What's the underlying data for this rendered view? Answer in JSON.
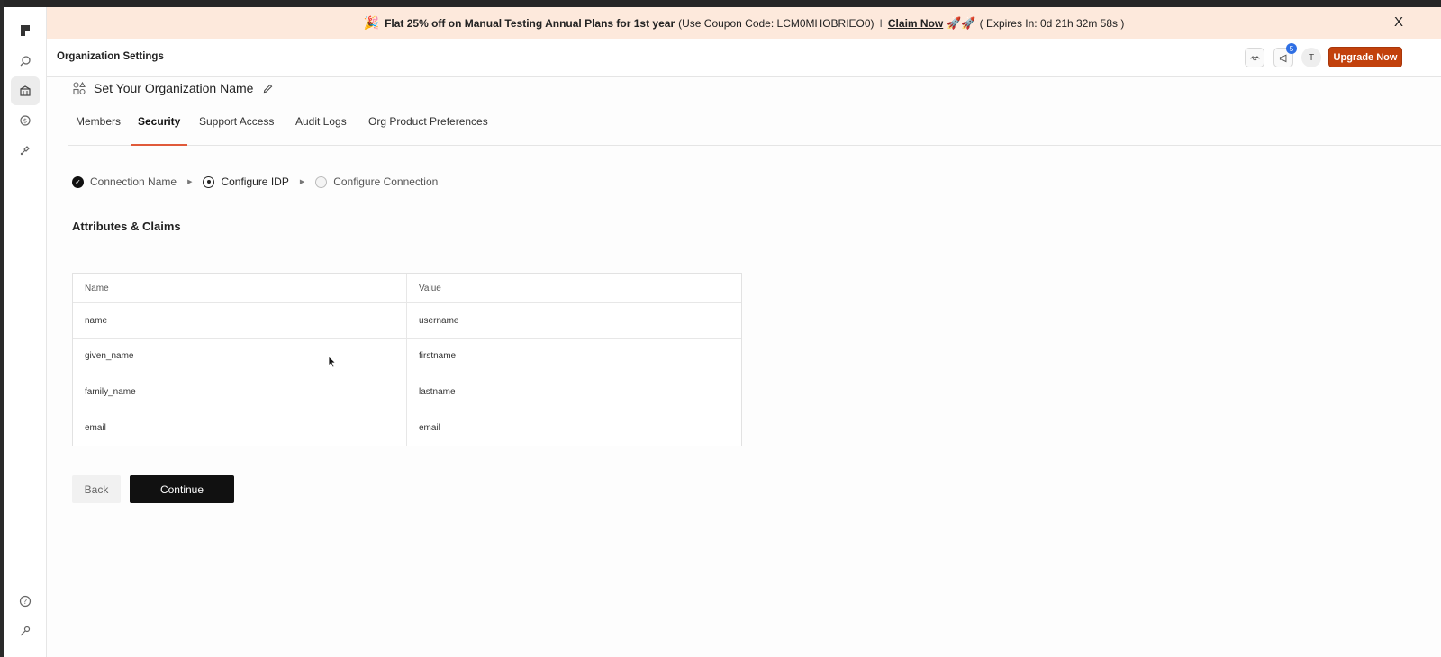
{
  "banner": {
    "emoji_left": "🎉",
    "promo_bold": "Flat 25% off on Manual Testing Annual Plans for 1st year",
    "coupon_text": "(Use Coupon Code: LCM0MHOBRIEO0)",
    "separator": "I",
    "claim_label": "Claim Now",
    "emoji_right": "🚀🚀",
    "expires_text": "( Expires In: 0d 21h 32m 58s )",
    "close_label": "X"
  },
  "header": {
    "title": "Organization Settings",
    "notifications_count": "5",
    "avatar_initial": "T",
    "upgrade_label": "Upgrade Now"
  },
  "org": {
    "name_label": "Set Your Organization Name"
  },
  "tabs": [
    {
      "label": "Members"
    },
    {
      "label": "Security"
    },
    {
      "label": "Support Access"
    },
    {
      "label": "Audit Logs"
    },
    {
      "label": "Org Product Preferences"
    }
  ],
  "active_tab": "Security",
  "stepper": [
    {
      "label": "Connection Name",
      "state": "done"
    },
    {
      "label": "Configure IDP",
      "state": "current"
    },
    {
      "label": "Configure Connection",
      "state": "todo"
    }
  ],
  "section_title": "Attributes & Claims",
  "claims_table": {
    "headers": [
      "Name",
      "Value"
    ],
    "rows": [
      [
        "name",
        "username"
      ],
      [
        "given_name",
        "firstname"
      ],
      [
        "family_name",
        "lastname"
      ],
      [
        "email",
        "email"
      ]
    ]
  },
  "actions": {
    "back_label": "Back",
    "continue_label": "Continue"
  },
  "colors": {
    "banner_bg": "#fde9dc",
    "upgrade_bg": "#c2410c",
    "tab_active_underline": "#e05a3a",
    "continue_bg": "#111111"
  }
}
